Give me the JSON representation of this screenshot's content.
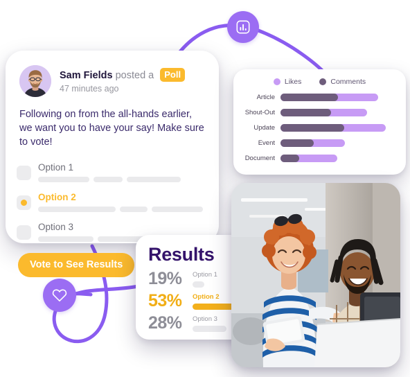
{
  "poll_card": {
    "author": "Sam Fields",
    "action": "posted a",
    "badge": "Poll",
    "timestamp": "47 minutes ago",
    "body": "Following on from the all-hands earlier, we want you to have your say! Make sure to vote!",
    "vote_button": "Vote to See Results",
    "options": [
      {
        "label": "Option 1",
        "selected": false
      },
      {
        "label": "Option 2",
        "selected": true
      },
      {
        "label": "Option 3",
        "selected": false
      }
    ],
    "accent_color": "#FBBA2D"
  },
  "chart_card": {
    "legend": [
      {
        "label": "Likes",
        "color": "#C79BF5"
      },
      {
        "label": "Comments",
        "color": "#6E5D7C"
      }
    ]
  },
  "chart_data": {
    "type": "bar",
    "orientation": "horizontal",
    "stacked": true,
    "title": "",
    "xlabel": "",
    "ylabel": "",
    "grid": false,
    "legend_position": "top-center",
    "categories": [
      "Article",
      "Shout-Out",
      "Update",
      "Event",
      "Document"
    ],
    "series": [
      {
        "name": "Comments",
        "color": "#6E5D7C",
        "values": [
          59,
          52,
          65,
          34,
          19
        ]
      },
      {
        "name": "Likes",
        "color": "#C79BF5",
        "values": [
          100,
          89,
          108,
          66,
          58
        ]
      }
    ],
    "xlim": [
      0,
      120
    ]
  },
  "results_card": {
    "title": "Results",
    "rows": [
      {
        "percent": "19%",
        "label": "Option 1",
        "value": 19,
        "highlight": false
      },
      {
        "percent": "53%",
        "label": "Option 2",
        "value": 53,
        "highlight": true
      },
      {
        "percent": "28%",
        "label": "Option 3",
        "value": 28,
        "highlight": false
      }
    ],
    "highlight_color": "#F3B01C"
  },
  "badges": [
    {
      "name": "chart-icon",
      "color": "#9B6DF3"
    },
    {
      "name": "heart-icon",
      "color": "#9B6DF3"
    }
  ],
  "photo_card": {
    "alt": "Two smiling colleagues in an office looking at a laptop"
  }
}
